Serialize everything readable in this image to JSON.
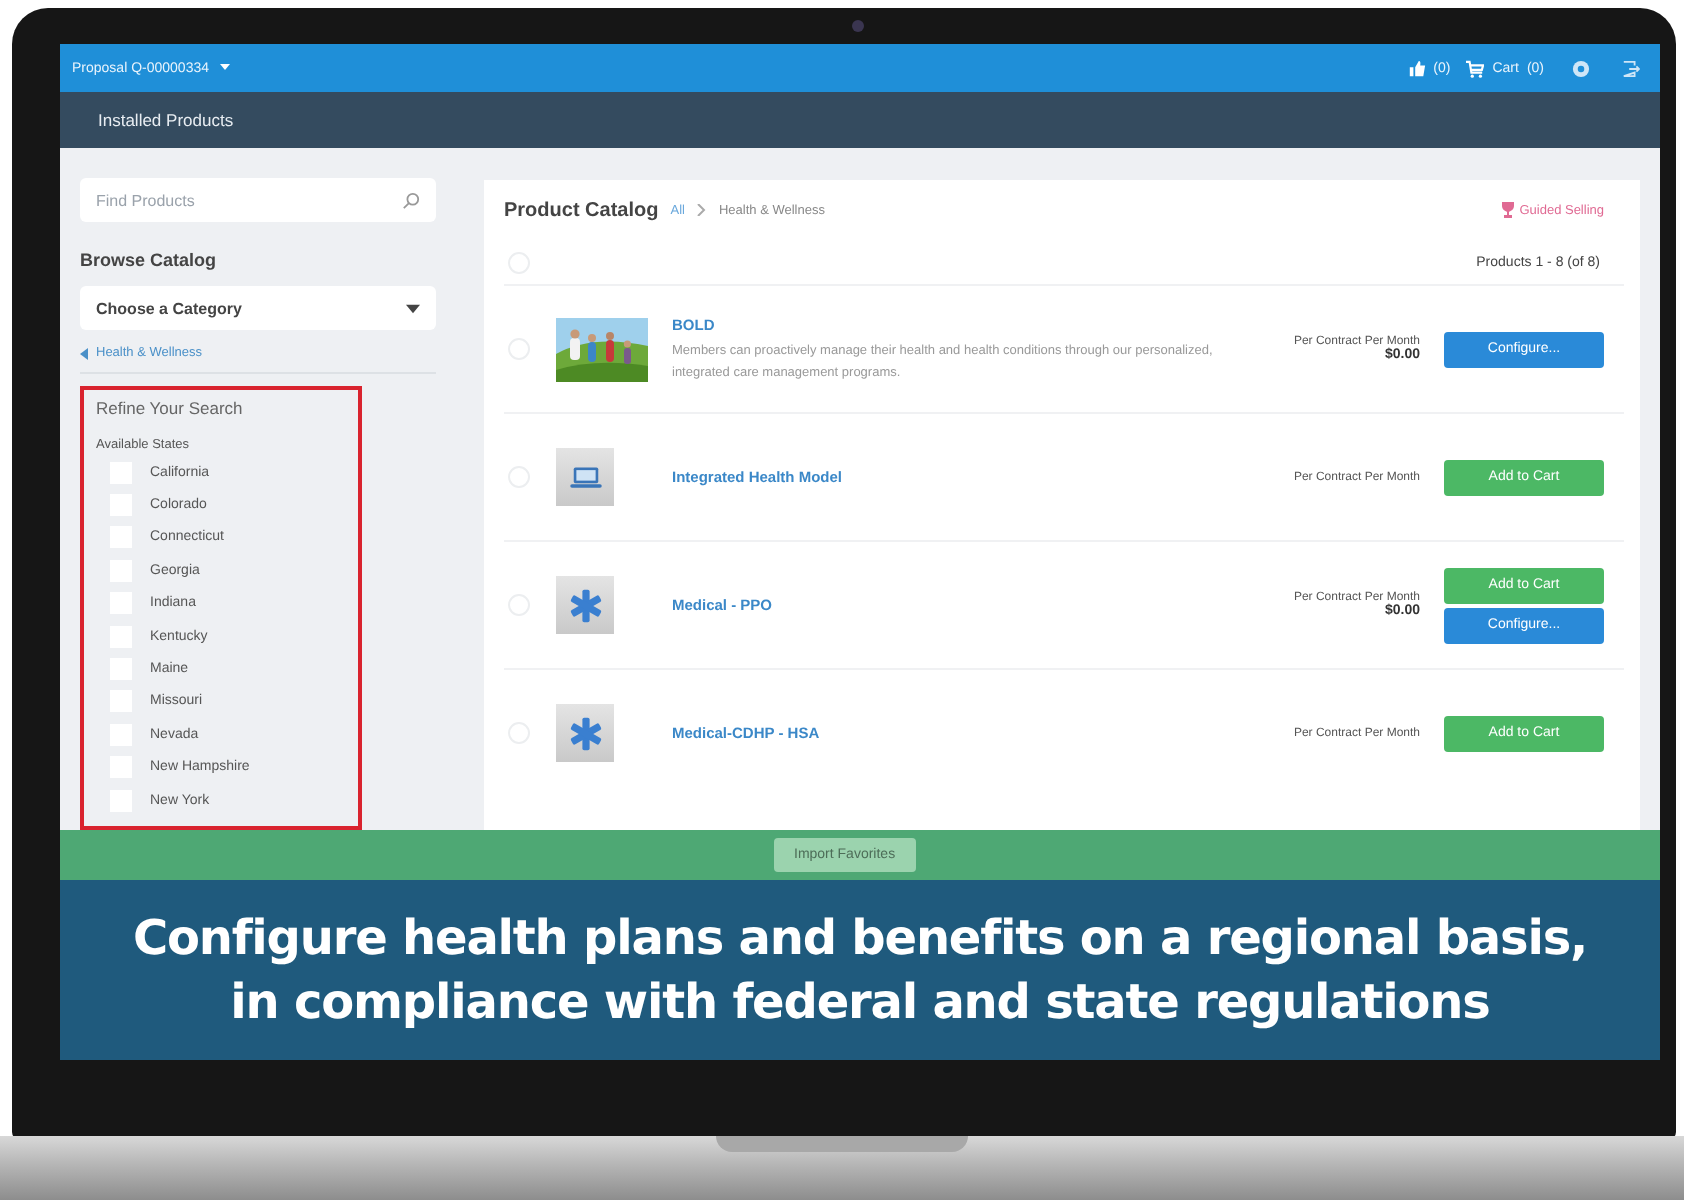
{
  "topbar": {
    "proposal": "Proposal Q-00000334",
    "favorites_count": "(0)",
    "cart_label": "Cart",
    "cart_count": "(0)"
  },
  "nav": {
    "title": "Installed Products"
  },
  "sidebar": {
    "search": {
      "placeholder": "Find Products"
    },
    "browse_title": "Browse Catalog",
    "category": {
      "value": "Choose a Category"
    },
    "back_link": "Health & Wellness",
    "refine": {
      "title": "Refine Your Search",
      "group": "Available States",
      "states": [
        {
          "label": "California",
          "checked": false
        },
        {
          "label": "Colorado",
          "checked": false
        },
        {
          "label": "Connecticut",
          "checked": false
        },
        {
          "label": "Georgia",
          "checked": false
        },
        {
          "label": "Indiana",
          "checked": false
        },
        {
          "label": "Kentucky",
          "checked": false
        },
        {
          "label": "Maine",
          "checked": false
        },
        {
          "label": "Missouri",
          "checked": false
        },
        {
          "label": "Nevada",
          "checked": false
        },
        {
          "label": "New Hampshire",
          "checked": false
        },
        {
          "label": "New York",
          "checked": false
        }
      ]
    }
  },
  "catalog": {
    "title": "Product Catalog",
    "breadcrumb": [
      "All",
      "Health & Wellness"
    ],
    "guided_selling": "Guided Selling",
    "select_all": {
      "selected": false
    },
    "count": "Products 1 - 8 (of 8)",
    "products": [
      {
        "name": "BOLD",
        "kind": "picture",
        "selected": false,
        "description": "Members can proactively manage their health and health conditions through our personalized, integrated care management programs.",
        "price_label": "Per Contract Per Month",
        "price": "$0.00",
        "buttons": [
          {
            "kind": "configure",
            "label": "Configure..."
          }
        ]
      },
      {
        "name": "Integrated Health Model",
        "kind": "laptop",
        "selected": false,
        "price_label": "Per Contract Per Month",
        "buttons": [
          {
            "kind": "add",
            "label": "Add to Cart"
          }
        ]
      },
      {
        "name": "Medical - PPO",
        "kind": "medical",
        "selected": false,
        "price_label": "Per Contract Per Month",
        "price": "$0.00",
        "buttons": [
          {
            "kind": "add",
            "label": "Add to Cart"
          },
          {
            "kind": "configure",
            "label": "Configure..."
          }
        ]
      },
      {
        "name": "Medical-CDHP - HSA",
        "kind": "medical",
        "selected": false,
        "price_label": "Per Contract Per Month",
        "buttons": [
          {
            "kind": "add",
            "label": "Add to Cart"
          }
        ]
      }
    ]
  },
  "footer": {
    "button": "Import Favorites"
  },
  "caption": [
    "Configure health plans and benefits on a regional basis,",
    "in compliance with federal and state regulations"
  ]
}
